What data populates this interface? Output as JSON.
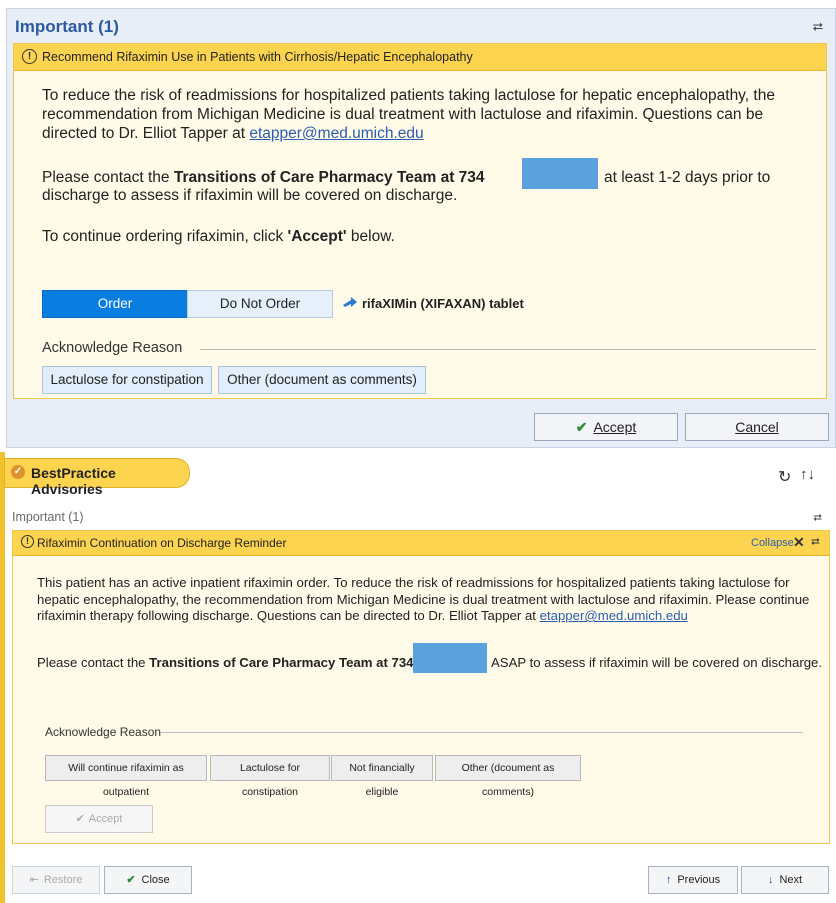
{
  "top": {
    "title": "Important (1)",
    "collapse_icon": "double-chevron-up",
    "alert_title": "Recommend Rifaximin Use in Patients with Cirrhosis/Hepatic Encephalopathy",
    "body_p1": "To reduce the risk of readmissions for hospitalized patients taking lactulose for hepatic encephalopathy, the recommendation from Michigan Medicine is dual treatment with lactulose and rifaximin. Questions can be directed to Dr. Elliot Tapper at ",
    "email": "etapper@med.umich.edu",
    "contact_prefix": "Please contact the ",
    "contact_bold": "Transitions of Care Pharmacy Team at 734",
    "contact_suffix_line1": "at least 1-2 days prior to",
    "contact_suffix_line2": "discharge to assess if rifaximin will be covered on discharge.",
    "continue_prefix": "To continue ordering rifaximin, click ",
    "continue_bold": "'Accept'",
    "continue_suffix": " below.",
    "order_label": "Order",
    "do_not_order_label": "Do Not Order",
    "medication": "rifaXIMin (XIFAXAN) tablet",
    "ack_reason_label": "Acknowledge Reason",
    "reasons": [
      "Lactulose for constipation",
      "Other (document as comments)"
    ],
    "accept_label": "Accept",
    "cancel_label": "Cancel"
  },
  "bottom": {
    "tab_label": "BestPractice Advisories",
    "refresh_icon": "refresh-icon",
    "sort_icon": "sort-icon",
    "important_label": "Important (1)",
    "alert_title": "Rifaximin Continuation on Discharge Reminder",
    "collapse_label": "Collapse",
    "body_p1": "This patient has an active inpatient rifaximin order.  To reduce the risk of readmissions for hospitalized patients taking lactulose for hepatic encephalopathy, the recommendation from Michigan Medicine is dual treatment with lactulose and rifaximin.  Please continue rifaximin therapy following discharge.  Questions can be directed to Dr. Elliot Tapper at ",
    "email": "etapper@med.umich.edu",
    "contact_prefix": "Please contact the ",
    "contact_bold": "Transitions of Care Pharmacy Team at 734",
    "contact_suffix": "ASAP to assess if rifaximin will be covered on discharge.",
    "ack_reason_label": "Acknowledge Reason",
    "reasons": [
      "Will continue rifaximin as outpatient",
      "Lactulose for constipation",
      "Not financially eligible",
      "Other (dcoument as comments)"
    ],
    "accept_label": "Accept",
    "restore_label": "Restore",
    "close_label": "Close",
    "previous_label": "Previous",
    "next_label": "Next"
  },
  "colors": {
    "accent_blue": "#0a7de0",
    "alert_yellow": "#fcd450",
    "redaction": "#5ba1dd"
  }
}
